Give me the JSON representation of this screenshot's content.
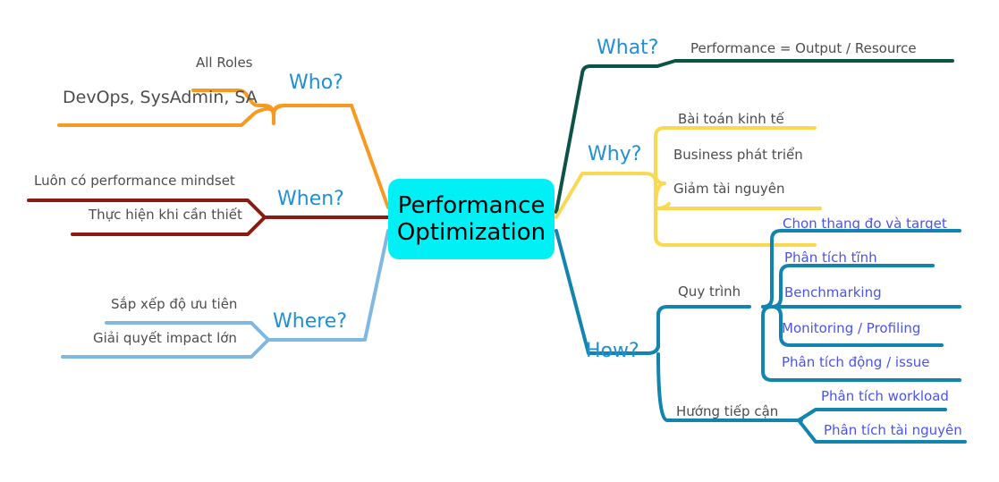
{
  "diagram": {
    "type": "mind-map",
    "title": "Performance Optimization",
    "center": {
      "line1": "Performance",
      "line2": "Optimization",
      "color": "#00f0f5"
    },
    "branches": [
      {
        "id": "who",
        "question": "Who?",
        "color": "#f79a1f",
        "side": "left",
        "children": [
          {
            "label": "All Roles"
          },
          {
            "label": "DevOps, SysAdmin, SA"
          }
        ]
      },
      {
        "id": "when",
        "question": "When?",
        "color": "#8b1a12",
        "side": "left",
        "children": [
          {
            "label": "Luôn có performance mindset"
          },
          {
            "label": "Thực hiện khi cần thiết"
          }
        ]
      },
      {
        "id": "where",
        "question": "Where?",
        "color": "#7fb8e3",
        "side": "left",
        "children": [
          {
            "label": "Sắp xếp độ ưu tiên"
          },
          {
            "label": "Giải quyết impact lớn"
          }
        ]
      },
      {
        "id": "what",
        "question": "What?",
        "color": "#0b5247",
        "side": "right",
        "children": [
          {
            "label": "Performance = Output / Resource"
          }
        ]
      },
      {
        "id": "why",
        "question": "Why?",
        "color": "#fad952",
        "side": "right",
        "children": [
          {
            "label": "Bài toán kinh tế"
          },
          {
            "label": "Business phát triển"
          },
          {
            "label": "Giảm tài nguyên"
          }
        ]
      },
      {
        "id": "how",
        "question": "How?",
        "color": "#1184b0",
        "side": "right",
        "groups": [
          {
            "label": "Quy trình",
            "children": [
              {
                "label": "Chọn thang đo và target"
              },
              {
                "label": "Phân tích tĩnh"
              },
              {
                "label": "Benchmarking"
              },
              {
                "label": "Monitoring / Profiling"
              },
              {
                "label": "Phân tích động / issue"
              }
            ]
          },
          {
            "label": "Hướng tiếp cận",
            "children": [
              {
                "label": "Phân tích workload"
              },
              {
                "label": "Phân tích tài nguyên"
              }
            ]
          }
        ]
      }
    ],
    "colors": {
      "background": "#ffffff",
      "center_fill": "#00f0f5",
      "center_text": "#000000",
      "question_text": "#1f8fd8",
      "leaf_text_dark": "#4d4d4d",
      "leaf_text_blue": "#4a53ef",
      "who": "#f79a1f",
      "when": "#8b1a12",
      "where": "#7fb8e3",
      "what": "#0b5247",
      "why": "#fad952",
      "how": "#1184b0"
    }
  }
}
